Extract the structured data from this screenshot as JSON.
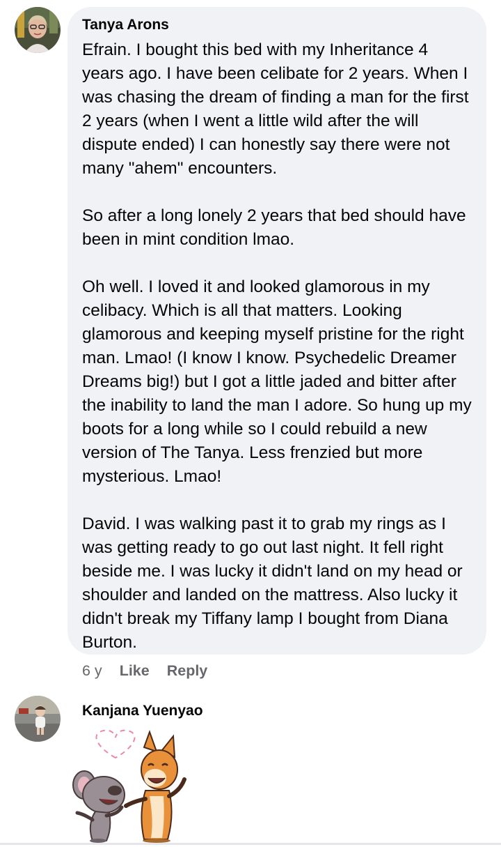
{
  "comment_1": {
    "author": "Tanya Arons",
    "paragraphs": [
      "Efrain.  I bought this bed with my Inheritance 4 years ago. I have been celibate for 2 years.  When I was chasing the dream of finding a man for the first 2 years (when I went a little wild after the will dispute ended) I can honestly say there were not many \"ahem\" encounters.",
      "So after a long lonely 2 years that bed should have been in mint condition lmao.",
      "Oh well.  I loved it and looked glamorous in my celibacy.  Which is all that matters. Looking glamorous and keeping myself pristine for the right man.  Lmao!  (I know I know.  Psychedelic Dreamer Dreams big!) but I got a little jaded and bitter after the inability to land the man I adore.  So hung up my boots for a long while so I could rebuild a new version of The Tanya.  Less frenzied but more mysterious.  Lmao!",
      "David.  I was walking past it to grab my rings as I was getting ready to go out last night.  It fell right beside me.  I was lucky it didn't land on my head or shoulder and landed on the mattress.  Also lucky it didn't break my Tiffany lamp I bought from Diana Burton."
    ],
    "time": "6 y",
    "like_label": "Like",
    "reply_label": "Reply"
  },
  "comment_2": {
    "author": "Kanjana Yuenyao",
    "sticker": "mouse-and-fox-love-sticker"
  },
  "colors": {
    "bubble": "#f0f2f5",
    "text": "#050505",
    "secondary_text": "#65676b"
  }
}
